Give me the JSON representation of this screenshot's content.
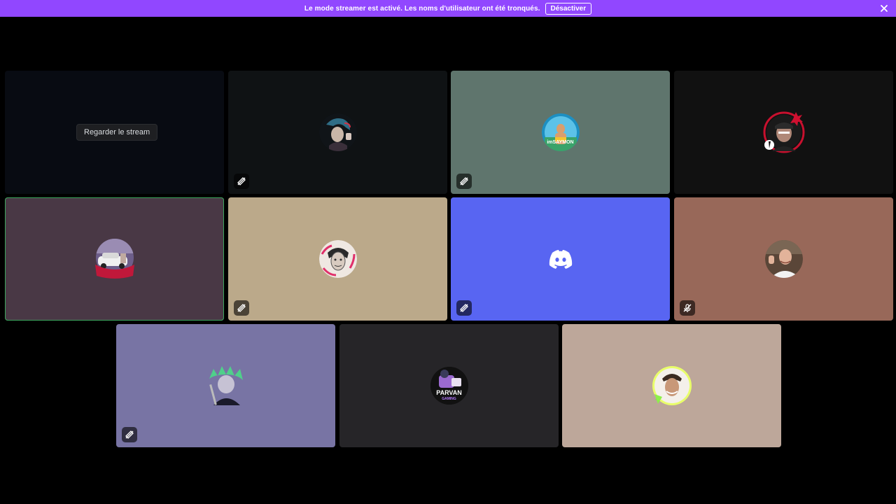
{
  "banner": {
    "message": "Le mode streamer est activé. Les noms d'utilisateur ont été tronqués.",
    "button_label": "Désactiver",
    "bg_color": "#9147ff"
  },
  "stream_tile": {
    "watch_label": "Regarder le stream"
  },
  "tiles": [
    {
      "id": "stream",
      "bg": "#080b12"
    },
    {
      "id": "user-2",
      "bg": "#0f1214",
      "muted": true,
      "avatar": "dark-teal-hair-avatar"
    },
    {
      "id": "user-3",
      "bg": "#5f756d",
      "muted": true,
      "avatar": "imsaymon-avatar",
      "avatar_text": "imSAYMON"
    },
    {
      "id": "user-4",
      "bg": "#111111",
      "muted": false,
      "avatar": "red-ring-avatar"
    },
    {
      "id": "user-5",
      "bg": "#493845",
      "muted": false,
      "speaking": true,
      "avatar": "car-avatar"
    },
    {
      "id": "user-6",
      "bg": "#bba98a",
      "muted": true,
      "avatar": "sketch-face-avatar"
    },
    {
      "id": "user-7",
      "bg": "#5865f2",
      "muted": true,
      "avatar": "discord-logo-icon"
    },
    {
      "id": "user-8",
      "bg": "#986859",
      "muted": true,
      "avatar": "photo-man-avatar"
    },
    {
      "id": "user-9",
      "bg": "#7874a4",
      "muted": true,
      "avatar": "green-hair-avatar"
    },
    {
      "id": "user-10",
      "bg": "#262528",
      "muted": false,
      "avatar": "parvan-avatar",
      "avatar_text": "PARVAN",
      "avatar_subtext": "GAMING"
    },
    {
      "id": "user-11",
      "bg": "#bda79a",
      "muted": false,
      "avatar": "green-frame-avatar"
    }
  ]
}
